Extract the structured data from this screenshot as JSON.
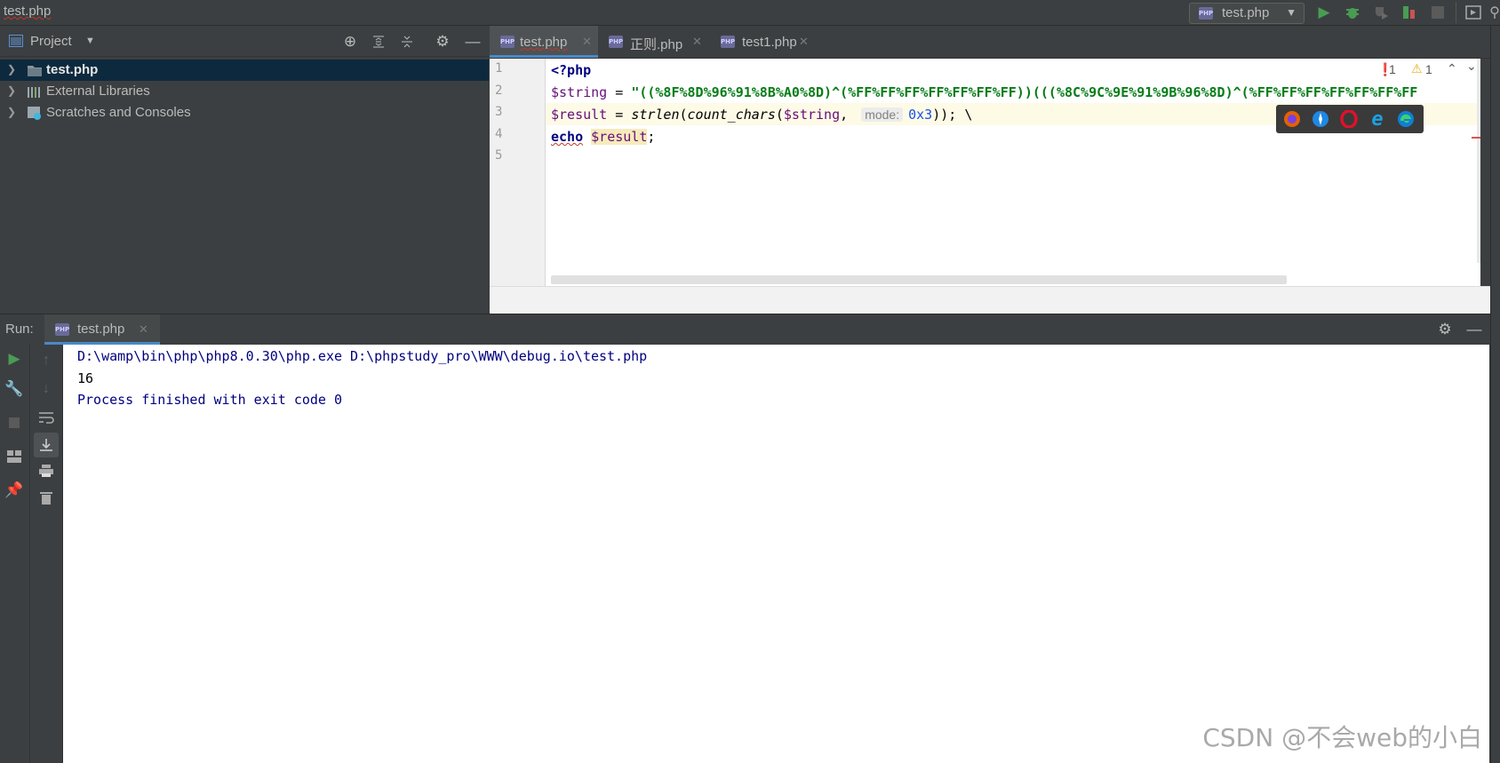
{
  "window": {
    "title": "test.php"
  },
  "toolbar": {
    "run_config": "test.php"
  },
  "project": {
    "header": "Project",
    "items": [
      {
        "label": "test.php"
      },
      {
        "label": "External Libraries"
      },
      {
        "label": "Scratches and Consoles"
      }
    ]
  },
  "editor": {
    "tabs": [
      {
        "label": "test.php"
      },
      {
        "label": "正则.php"
      },
      {
        "label": "test1.php"
      }
    ],
    "line_numbers": [
      "1",
      "2",
      "3",
      "4",
      "5"
    ],
    "code": {
      "l1": "<?php",
      "l2_var": "$string",
      "l2_eq": " = ",
      "l2_str": "\"((%8F%8D%96%91%8B%A0%8D)^(%FF%FF%FF%FF%FF%FF%FF))(((%8C%9C%9E%91%9B%96%8D)^(%FF%FF%FF%FF%FF%FF%FF",
      "l3_var": "$result",
      "l3_eq": " = ",
      "l3_fn1": "strlen",
      "l3_p1": "(",
      "l3_fn2": "count_chars",
      "l3_p2": "(",
      "l3_arg": "$string",
      "l3_comma": ",",
      "l3_hint": "mode:",
      "l3_num": "0x3",
      "l3_end": ")); \\",
      "l4_kw": "echo",
      "l4_var": "$result",
      "l4_semi": ";"
    },
    "inspections": {
      "errors": "1",
      "warnings": "1"
    }
  },
  "run": {
    "label": "Run:",
    "tab": "test.php",
    "console": [
      "D:\\wamp\\bin\\php\\php8.0.30\\php.exe D:\\phpstudy_pro\\WWW\\debug.io\\test.php",
      "16",
      "Process finished with exit code 0"
    ]
  },
  "watermark": "CSDN @不会web的小白",
  "colors": {
    "accent_green": "#499c54",
    "selection": "#0d293e",
    "keyword": "#000080",
    "string": "#067d17",
    "variable": "#660e7a"
  }
}
